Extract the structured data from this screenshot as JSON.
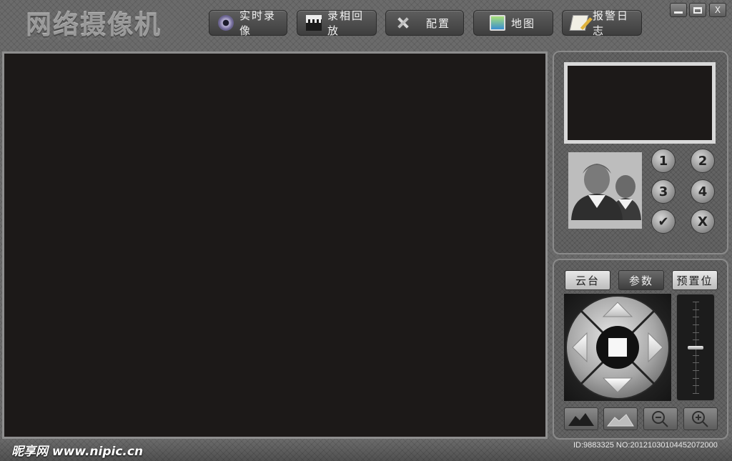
{
  "app": {
    "title": "网络摄像机"
  },
  "nav": [
    {
      "label": "实时录像",
      "icon": "record-icon"
    },
    {
      "label": "录相回放",
      "icon": "clapper-icon"
    },
    {
      "label": "配置",
      "icon": "tools-icon"
    },
    {
      "label": "地图",
      "icon": "map-icon"
    },
    {
      "label": "报警日志",
      "icon": "alarm-log-icon"
    }
  ],
  "window_controls": {
    "minimize": "",
    "maximize": "",
    "close": "X"
  },
  "camera_buttons": [
    "1",
    "2",
    "3",
    "4",
    "✔",
    "X"
  ],
  "control_tabs": [
    {
      "label": "云台",
      "active": true
    },
    {
      "label": "参数",
      "active": false
    },
    {
      "label": "预置位",
      "active": false
    }
  ],
  "footer": {
    "watermark": "昵享网 www.nipic.cn",
    "id_text": "ID:9883325 NO:20121030104452072000"
  },
  "zoom": {
    "level": 0.5
  },
  "colors": {
    "video_bg": "#1c1918",
    "panel": "#636363",
    "frame": "#8e8e8e"
  }
}
